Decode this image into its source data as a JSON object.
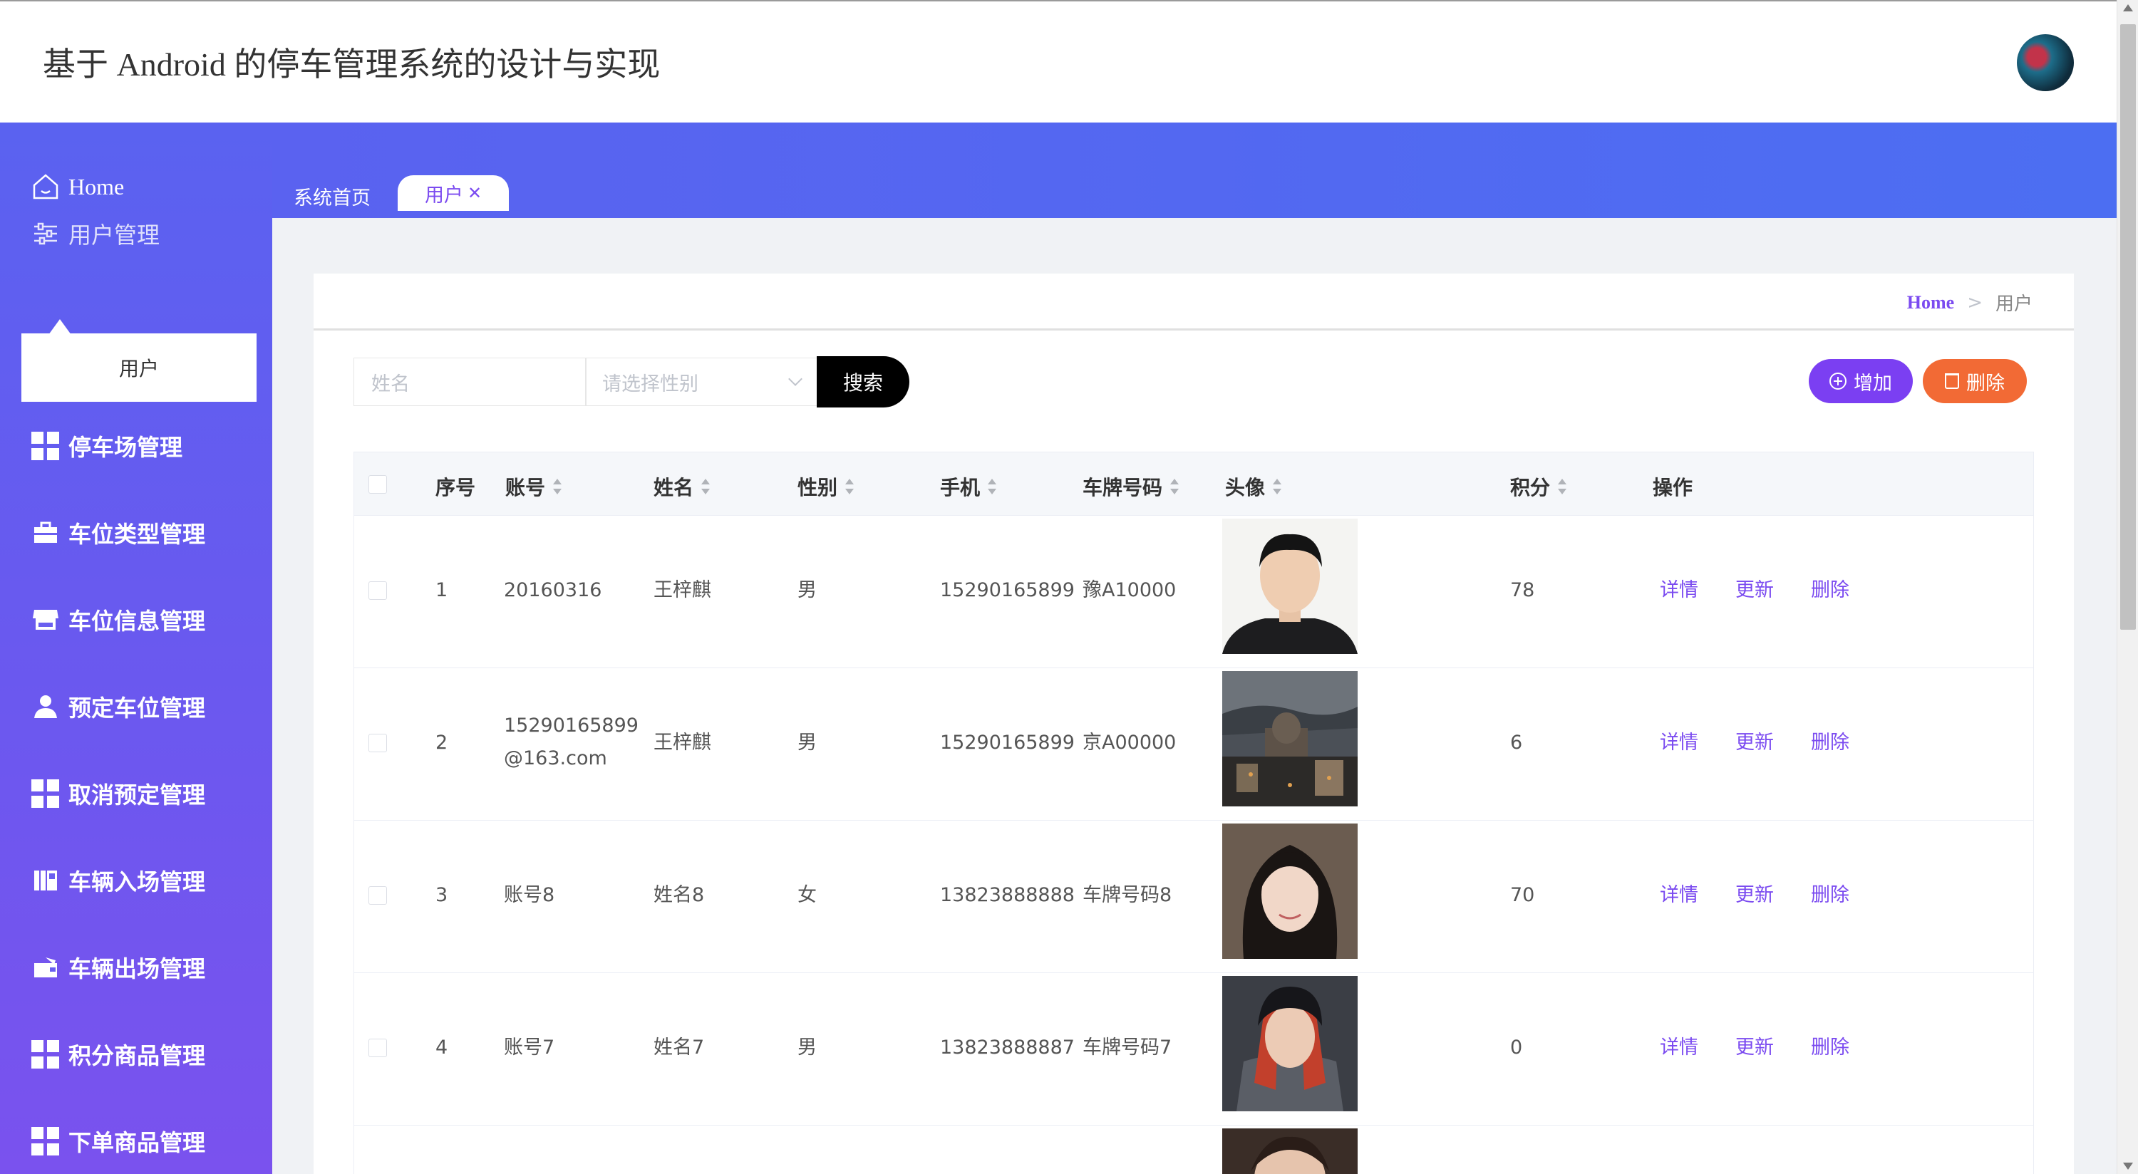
{
  "app": {
    "title": "基于 Android 的停车管理系统的设计与实现"
  },
  "sidebar": {
    "home_label": "Home",
    "user_mgmt_label": "用户管理",
    "user_sub_label": "用户",
    "items": [
      {
        "label": "停车场管理",
        "icon": "grid-icon"
      },
      {
        "label": "车位类型管理",
        "icon": "briefcase-icon"
      },
      {
        "label": "车位信息管理",
        "icon": "store-icon"
      },
      {
        "label": "预定车位管理",
        "icon": "person-icon"
      },
      {
        "label": "取消预定管理",
        "icon": "grid-icon"
      },
      {
        "label": "车辆入场管理",
        "icon": "books-icon"
      },
      {
        "label": "车辆出场管理",
        "icon": "wallet-icon"
      },
      {
        "label": "积分商品管理",
        "icon": "grid-icon"
      },
      {
        "label": "下单商品管理",
        "icon": "grid-icon"
      }
    ]
  },
  "tabs": {
    "home": "系统首页",
    "active": "用户",
    "close": "✕"
  },
  "breadcrumb": {
    "home": "Home",
    "sep": ">",
    "current": "用户"
  },
  "search": {
    "name_placeholder": "姓名",
    "gender_placeholder": "请选择性别",
    "button": "搜索"
  },
  "actions": {
    "add": "增加",
    "delete": "删除"
  },
  "table": {
    "headers": [
      "序号",
      "账号",
      "姓名",
      "性别",
      "手机",
      "车牌号码",
      "头像",
      "积分",
      "操作"
    ],
    "row_actions": {
      "detail": "详情",
      "update": "更新",
      "delete": "删除"
    },
    "rows": [
      {
        "index": "1",
        "account": "20160316",
        "account2": "",
        "name": "王梓麒",
        "gender": "男",
        "phone": "15290165899",
        "plate": "豫A10000",
        "points": "78"
      },
      {
        "index": "2",
        "account": "15290165899",
        "account2": "@163.com",
        "name": "王梓麒",
        "gender": "男",
        "phone": "15290165899",
        "plate": "京A00000",
        "points": "6"
      },
      {
        "index": "3",
        "account": "账号8",
        "account2": "",
        "name": "姓名8",
        "gender": "女",
        "phone": "13823888888",
        "plate": "车牌号码8",
        "points": "70"
      },
      {
        "index": "4",
        "account": "账号7",
        "account2": "",
        "name": "姓名7",
        "gender": "男",
        "phone": "13823888887",
        "plate": "车牌号码7",
        "points": "0"
      }
    ]
  }
}
